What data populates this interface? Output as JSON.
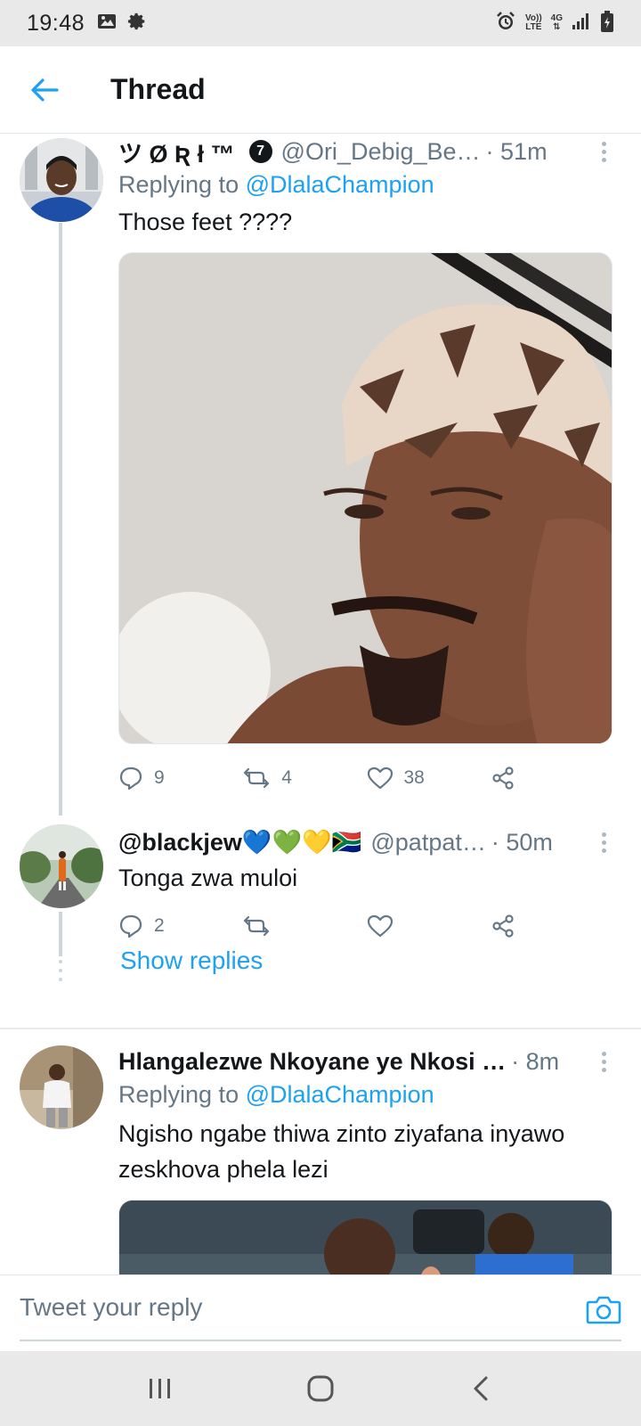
{
  "status_bar": {
    "time": "19:48",
    "left_icons": [
      "image-icon",
      "gear-icon"
    ],
    "right_icons": [
      "alarm-icon",
      "volte-icon",
      "4g-icon",
      "signal-icon",
      "battery-icon"
    ],
    "volte_top": "Vo))",
    "volte_bottom": "LTE",
    "net_type": "4G"
  },
  "header": {
    "back_icon": "arrow-left-icon",
    "title": "Thread"
  },
  "colors": {
    "accent": "#1da1f2",
    "text_primary": "#14171a",
    "text_secondary": "#657786"
  },
  "tweets": [
    {
      "name": "ツ Ø Ʀ ł ™",
      "badge": "7",
      "handle": "@Ori_Debig_Be…",
      "time": "· 51m",
      "replying_prefix": "Replying to ",
      "replying_to": "@DlalaChampion",
      "text": "Those feet ????",
      "reply_count": "9",
      "retweet_count": "4",
      "like_count": "38"
    },
    {
      "name": "@blackjew💙💚💛🇿🇦",
      "handle": "@patpat…",
      "time": "· 50m",
      "text": "Tonga zwa muloi",
      "reply_count": "2",
      "retweet_count": "",
      "like_count": "",
      "show_replies": "Show replies"
    },
    {
      "name": "Hlangalezwe Nkoyane ye Nkosi …",
      "time": "· 8m",
      "replying_prefix": "Replying to ",
      "replying_to": "@DlalaChampion",
      "text": "Ngisho ngabe thiwa zinto ziyafana inyawo zeskhova phela lezi"
    }
  ],
  "composer": {
    "placeholder": "Tweet your reply",
    "camera_icon": "camera-icon"
  },
  "nav": [
    "recents-icon",
    "home-icon",
    "back-icon"
  ]
}
